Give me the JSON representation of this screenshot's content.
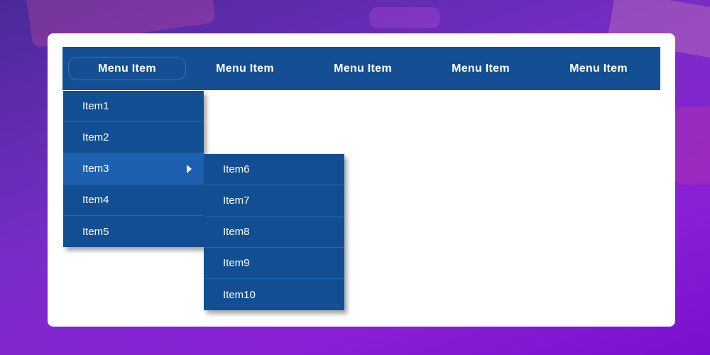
{
  "menubar": {
    "items": [
      {
        "label": "Menu Item"
      },
      {
        "label": "Menu Item"
      },
      {
        "label": "Menu Item"
      },
      {
        "label": "Menu Item"
      },
      {
        "label": "Menu Item"
      }
    ]
  },
  "dropdown": {
    "items": [
      {
        "label": "Item1"
      },
      {
        "label": "Item2"
      },
      {
        "label": "Item3"
      },
      {
        "label": "Item4"
      },
      {
        "label": "Item5"
      }
    ]
  },
  "submenu": {
    "items": [
      {
        "label": "Item6"
      },
      {
        "label": "Item7"
      },
      {
        "label": "Item8"
      },
      {
        "label": "Item9"
      },
      {
        "label": "Item10"
      }
    ]
  },
  "colors": {
    "menu_bg": "#134f92",
    "highlight_bg": "#1c60af",
    "card_bg": "#ffffff",
    "text": "#ffffff"
  }
}
